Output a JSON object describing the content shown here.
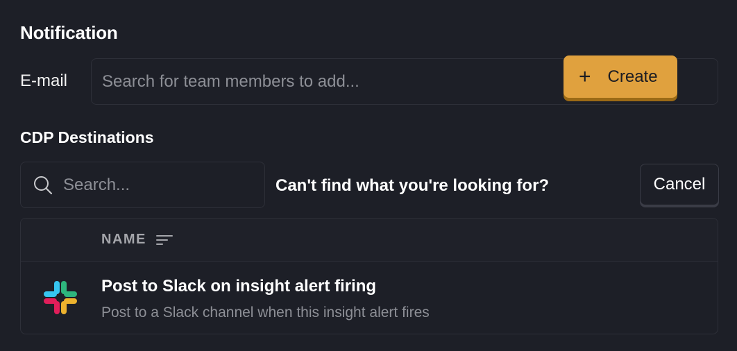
{
  "notification": {
    "title": "Notification",
    "email_label": "E-mail",
    "email_placeholder": "Search for team members to add..."
  },
  "cdp": {
    "title": "CDP Destinations",
    "search_placeholder": "Search...",
    "cant_find": "Can't find what you're looking for?",
    "cancel_label": "Cancel",
    "table": {
      "columns": [
        "NAME"
      ],
      "rows": [
        {
          "title": "Post to Slack on insight alert firing",
          "description": "Post to a Slack channel when this insight alert fires",
          "icon": "slack-icon",
          "action_label": "Create"
        }
      ]
    }
  },
  "colors": {
    "background": "#1d1f27",
    "border": "#2e3039",
    "accent": "#e0a13e",
    "muted_text": "#8d8f96"
  }
}
